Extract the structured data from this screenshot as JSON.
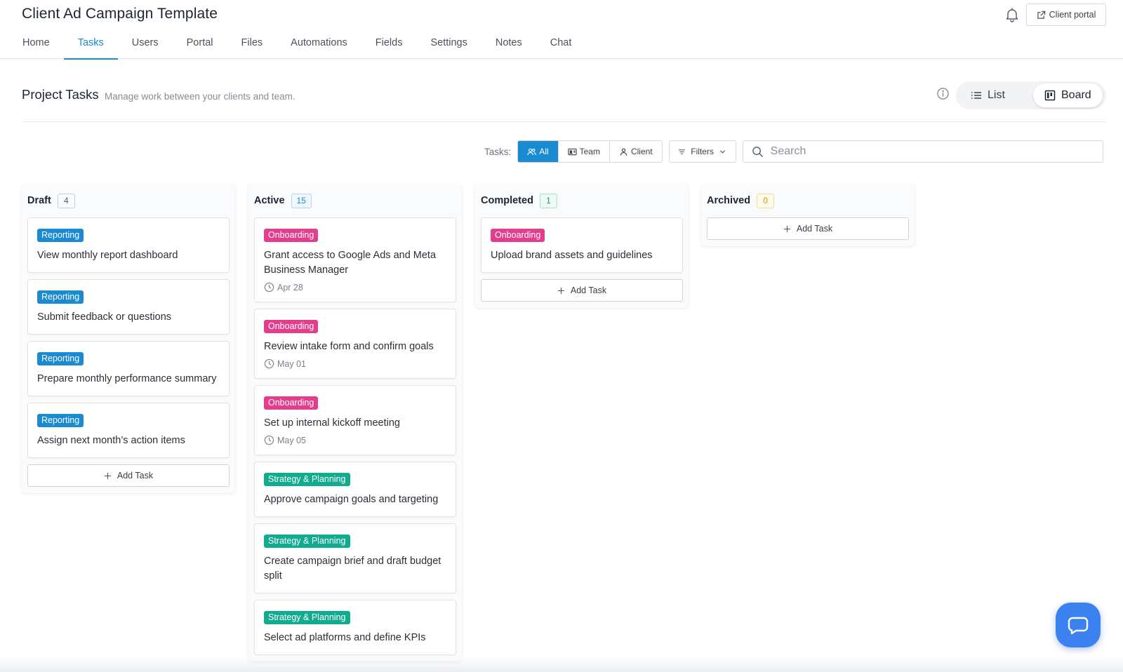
{
  "header": {
    "title": "Client Ad Campaign Template",
    "client_portal_label": "Client portal",
    "icons": {
      "notifications": "bell-icon",
      "client_portal": "external-link-icon"
    }
  },
  "tabs": [
    {
      "label": "Home",
      "active": false
    },
    {
      "label": "Tasks",
      "active": true
    },
    {
      "label": "Users",
      "active": false
    },
    {
      "label": "Portal",
      "active": false
    },
    {
      "label": "Files",
      "active": false
    },
    {
      "label": "Automations",
      "active": false
    },
    {
      "label": "Fields",
      "active": false
    },
    {
      "label": "Settings",
      "active": false
    },
    {
      "label": "Notes",
      "active": false
    },
    {
      "label": "Chat",
      "active": false
    }
  ],
  "page": {
    "title": "Project Tasks",
    "subtitle": "Manage work between your clients and team.",
    "views": {
      "list_label": "List",
      "board_label": "Board",
      "selected": "Board"
    }
  },
  "toolbar": {
    "tasks_label": "Tasks:",
    "segments": [
      {
        "label": "All",
        "icon": "users-icon",
        "selected": true
      },
      {
        "label": "Team",
        "icon": "id-card-icon",
        "selected": false
      },
      {
        "label": "Client",
        "icon": "user-icon",
        "selected": false
      }
    ],
    "filters_label": "Filters",
    "search_placeholder": "Search"
  },
  "colors": {
    "accent": "#1b8bd1",
    "tag_reporting": "#1b8bd1",
    "tag_onboarding": "#e33d8e",
    "tag_strategy": "#11ab8e",
    "chat_button": "#3b82f0"
  },
  "add_task_label": "Add Task",
  "columns": [
    {
      "name": "Draft",
      "count": "4",
      "cards": [
        {
          "tag": "Reporting",
          "title": "View monthly report dashboard"
        },
        {
          "tag": "Reporting",
          "title": "Submit feedback or questions"
        },
        {
          "tag": "Reporting",
          "title": "Prepare monthly performance summary"
        },
        {
          "tag": "Reporting",
          "title": "Assign next month’s action items"
        }
      ]
    },
    {
      "name": "Active",
      "count": "15",
      "cards": [
        {
          "tag": "Onboarding",
          "title": "Grant access to Google Ads and Meta Business Manager",
          "date": "Apr 28"
        },
        {
          "tag": "Onboarding",
          "title": "Review intake form and confirm goals",
          "date": "May 01"
        },
        {
          "tag": "Onboarding",
          "title": "Set up internal kickoff meeting",
          "date": "May 05"
        },
        {
          "tag": "Strategy & Planning",
          "title": "Approve campaign goals and targeting"
        },
        {
          "tag": "Strategy & Planning",
          "title": "Create campaign brief and draft budget split"
        },
        {
          "tag": "Strategy & Planning",
          "title": "Select ad platforms and define KPIs"
        }
      ]
    },
    {
      "name": "Completed",
      "count": "1",
      "cards": [
        {
          "tag": "Onboarding",
          "title": "Upload brand assets and guidelines"
        }
      ]
    },
    {
      "name": "Archived",
      "count": "0",
      "cards": []
    }
  ]
}
